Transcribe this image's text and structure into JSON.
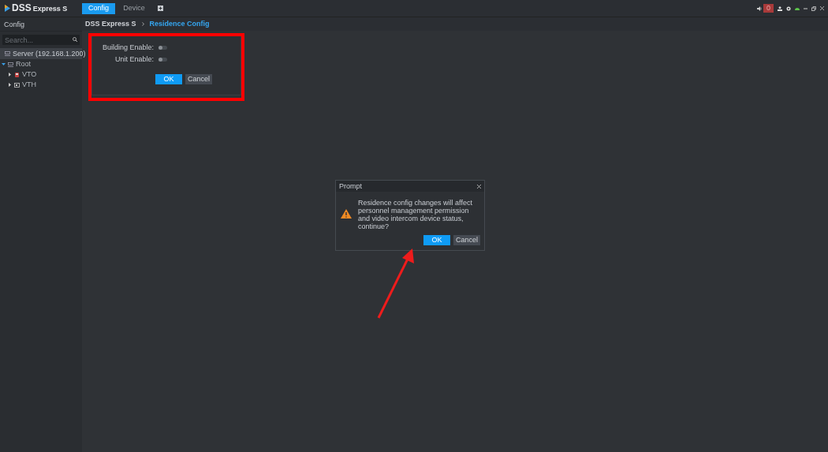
{
  "app": {
    "logo": "DSS",
    "edition": "Express S"
  },
  "tabs": [
    {
      "label": "Config",
      "selected": true
    },
    {
      "label": "Device",
      "selected": false
    }
  ],
  "alarm_count": "0",
  "sidebar": {
    "title": "Config",
    "search": {
      "placeholder": "Search..."
    },
    "server": {
      "label": "Server (192.168.1.200)",
      "selected": true
    },
    "tree": [
      {
        "label": "Root",
        "kind": "org",
        "expanded": true,
        "children": [
          {
            "label": "VTO",
            "kind": "vto",
            "expanded": false
          },
          {
            "label": "VTH",
            "kind": "vth",
            "expanded": false
          }
        ]
      }
    ]
  },
  "breadcrumb": [
    {
      "label": "DSS Express S",
      "current": false
    },
    {
      "label": "Residence Config",
      "current": true
    }
  ],
  "form": {
    "fields": [
      {
        "label": "Building Enable:",
        "on": false
      },
      {
        "label": "Unit Enable:",
        "on": false
      }
    ],
    "buttons": [
      {
        "label": "OK",
        "kind": "primary"
      },
      {
        "label": "Cancel",
        "kind": "secondary"
      }
    ]
  },
  "dialog": {
    "title": "Prompt",
    "message": "Residence config changes will affect personnel management permission and video intercom device status, continue?",
    "buttons": [
      {
        "label": "OK",
        "kind": "primary"
      },
      {
        "label": "Cancel",
        "kind": "secondary"
      }
    ]
  }
}
